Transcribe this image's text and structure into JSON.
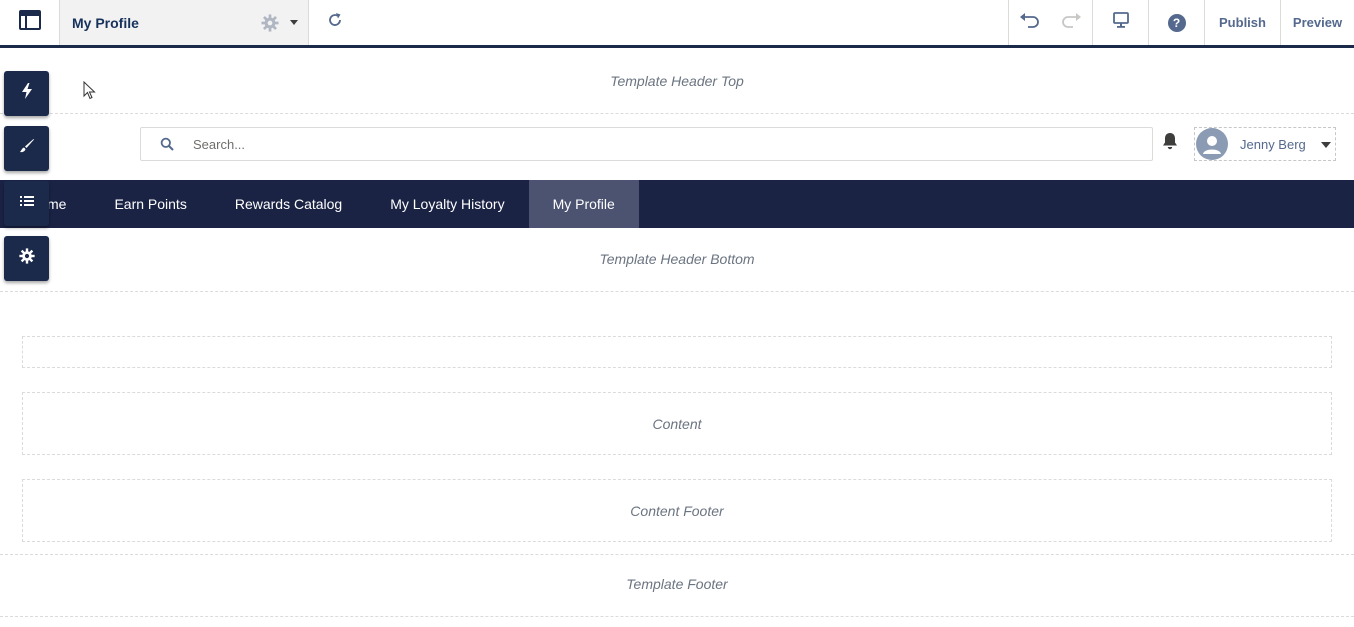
{
  "toolbar": {
    "app_icon": "layout-icon",
    "page_title": "My Profile",
    "page_settings_icon": "gear-icon",
    "refresh_icon": "refresh-icon",
    "undo_icon": "undo-icon",
    "redo_icon": "redo-icon",
    "device_icon": "desktop-icon",
    "help_label": "?",
    "publish_label": "Publish",
    "preview_label": "Preview"
  },
  "side_panel": {
    "buttons": [
      {
        "icon": "lightning-icon"
      },
      {
        "icon": "brush-icon"
      },
      {
        "icon": "list-icon"
      },
      {
        "icon": "gear-icon"
      }
    ]
  },
  "regions": {
    "header_top": "Template Header Top",
    "header_bottom": "Template Header Bottom",
    "content": "Content",
    "content_footer": "Content Footer",
    "footer": "Template Footer"
  },
  "header": {
    "search_placeholder": "Search...",
    "notification_icon": "bell-icon",
    "user_name": "Jenny Berg"
  },
  "nav": {
    "items": [
      {
        "label": "me"
      },
      {
        "label": "Earn Points"
      },
      {
        "label": "Rewards Catalog"
      },
      {
        "label": "My Loyalty History"
      },
      {
        "label": "My Profile",
        "active": true
      }
    ]
  },
  "colors": {
    "toolbar_border": "#1b2a4b",
    "nav_background": "#1b2345",
    "nav_active": "#4b5371",
    "side_button": "#1b2a4b"
  }
}
